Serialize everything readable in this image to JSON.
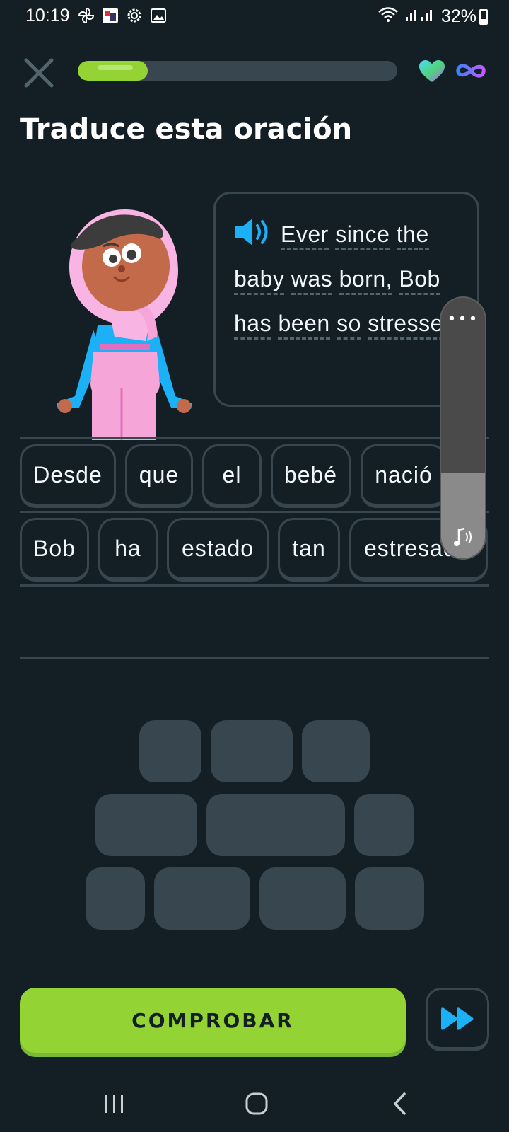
{
  "status_bar": {
    "time": "10:19",
    "battery": "32%",
    "battery_level": 0.32
  },
  "lesson": {
    "progress": 0.22,
    "title": "Traduce esta oración",
    "accent_color": "#93d333",
    "track_color": "#37464f"
  },
  "prompt": {
    "words": [
      "Ever",
      "since",
      "the",
      "baby",
      "was",
      "born,",
      "Bob",
      "has",
      "been",
      "so",
      "stressed!"
    ]
  },
  "volume": {
    "dots": "•••",
    "level": 0.33
  },
  "answer": {
    "row1": [
      "Desde",
      "que",
      "el",
      "bebé",
      "nació"
    ],
    "row2": [
      "Bob",
      "ha",
      "estado",
      "tan",
      "estresado"
    ]
  },
  "buttons": {
    "check_label": "COMPROBAR"
  },
  "icons": {
    "close": "close-icon",
    "heart": "heart-icon",
    "infinity": "infinity-icon",
    "speaker": "speaker-icon",
    "skip": "fast-forward-icon",
    "nav_recent": "recent-apps-icon",
    "nav_home": "home-icon",
    "nav_back": "back-icon"
  }
}
